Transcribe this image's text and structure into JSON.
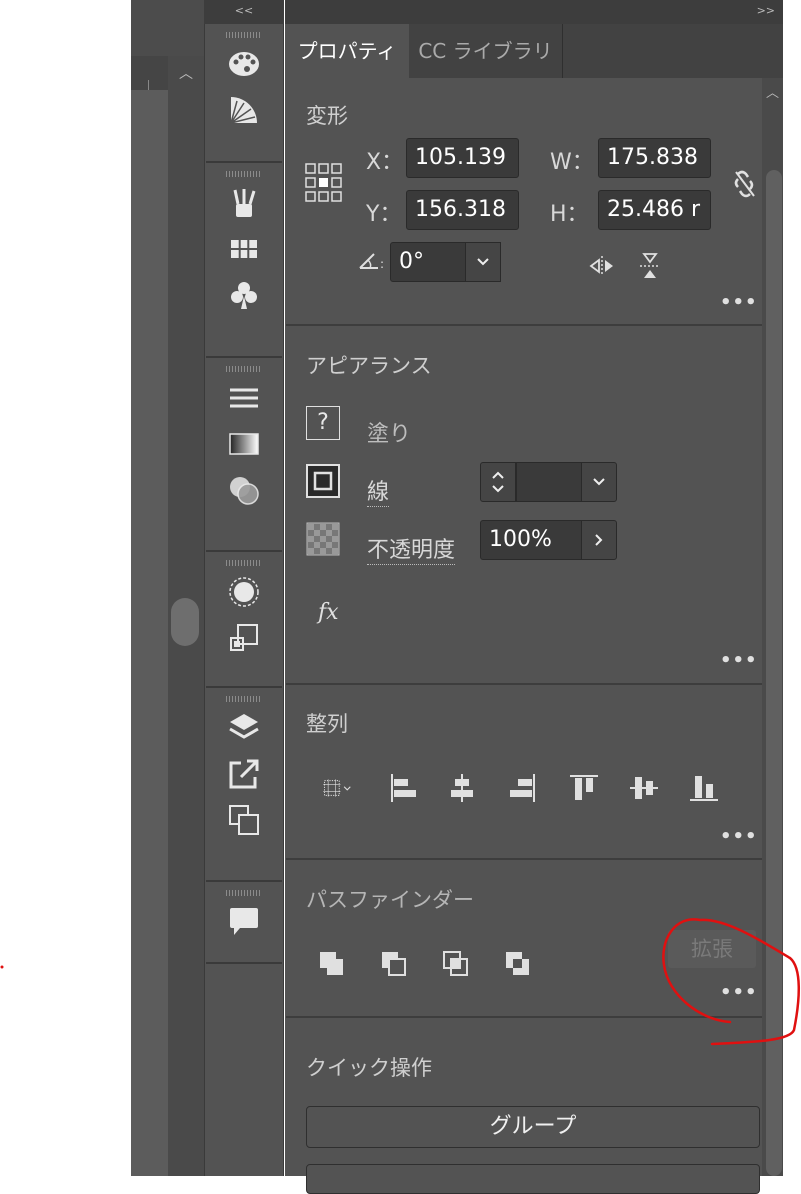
{
  "canvas": {
    "scroll_up_glyph": "︿"
  },
  "toolstrip": {
    "collapse_glyph": "<<",
    "icons": [
      "color-palette-icon",
      "color-guide-icon",
      "brushes-icon",
      "swatches-icon",
      "symbols-icon",
      "stroke-icon",
      "gradient-icon",
      "transparency-icon",
      "appearance-icon",
      "graphic-styles-icon",
      "layers-icon",
      "export-icon",
      "artboards-icon",
      "comments-icon"
    ]
  },
  "panel": {
    "collapse_glyph": ">>",
    "tabs": [
      {
        "label": "プロパティ",
        "active": true
      },
      {
        "label": "CC ライブラリ",
        "active": false
      }
    ],
    "transform": {
      "title": "変形",
      "x_label": "X：",
      "x_value": "105.139",
      "y_label": "Y：",
      "y_value": "156.318",
      "w_label": "W：",
      "w_value": "175.838",
      "h_label": "H：",
      "h_value": "25.486 r",
      "angle_value": "0°",
      "more": "•••"
    },
    "appearance": {
      "title": "アピアランス",
      "fill_label": "塗り",
      "fill_glyph": "?",
      "stroke_label": "線",
      "opacity_label": "不透明度",
      "opacity_value": "100%",
      "fx_label": "fx",
      "more": "•••"
    },
    "align": {
      "title": "整列",
      "more": "•••"
    },
    "pathfinder": {
      "title": "パスファインダー",
      "expand_label": "拡張",
      "more": "•••"
    },
    "quick_actions": {
      "title": "クイック操作",
      "group_label": "グループ"
    }
  },
  "colors": {
    "annotation": "#e01010",
    "panel_bg": "#535353",
    "field_bg": "#3a3a3a"
  }
}
